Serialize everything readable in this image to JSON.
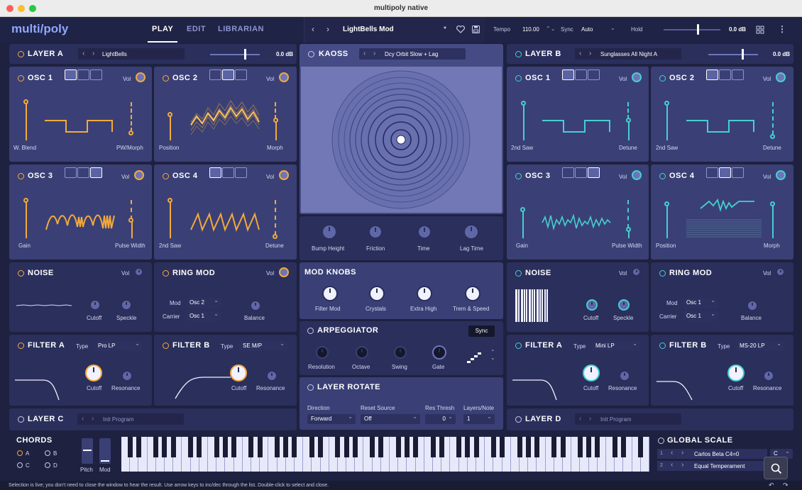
{
  "window": {
    "title": "multipoly native"
  },
  "header": {
    "logo": "multi/poly",
    "tabs": [
      {
        "label": "PLAY"
      },
      {
        "label": "EDIT"
      },
      {
        "label": "LIBRARIAN"
      }
    ],
    "preset_name": "LightBells Mod",
    "preset_modified": "*",
    "tempo_label": "Tempo",
    "tempo_value": "110.00",
    "sync_label": "Sync",
    "sync_value": "Auto",
    "hold_label": "Hold",
    "master_db": "0.0 dB"
  },
  "layer_a": {
    "title": "LAYER A",
    "program": "LightBells",
    "db": "0.0 dB",
    "osc1": {
      "title": "OSC 1",
      "vol": "Vol",
      "left": "W. Blend",
      "right": "PW/Morph"
    },
    "osc2": {
      "title": "OSC 2",
      "vol": "Vol",
      "left": "Position",
      "right": "Morph"
    },
    "osc3": {
      "title": "OSC 3",
      "vol": "Vol",
      "left": "Gain",
      "right": "Pulse Width"
    },
    "osc4": {
      "title": "OSC 4",
      "vol": "Vol",
      "left": "2nd Saw",
      "right": "Detune"
    },
    "noise": {
      "title": "NOISE",
      "vol": "Vol",
      "k1": "Cutoff",
      "k2": "Speckle"
    },
    "ringmod": {
      "title": "RING MOD",
      "vol": "Vol",
      "mod_label": "Mod",
      "mod_value": "Osc 2",
      "carrier_label": "Carrier",
      "carrier_value": "Osc 1",
      "k1": "Balance"
    },
    "filter_a": {
      "title": "FILTER A",
      "type_label": "Type",
      "type_value": "Pro LP",
      "k1": "Cutoff",
      "k2": "Resonance"
    },
    "filter_b": {
      "title": "FILTER B",
      "type_label": "Type",
      "type_value": "SE M/P",
      "k1": "Cutoff",
      "k2": "Resonance"
    }
  },
  "layer_b": {
    "title": "LAYER B",
    "program": "Sunglasses All Night A",
    "db": "0.0 dB",
    "osc1": {
      "title": "OSC 1",
      "vol": "Vol",
      "left": "2nd Saw",
      "right": "Detune"
    },
    "osc2": {
      "title": "OSC 2",
      "vol": "Vol",
      "left": "2nd Saw",
      "right": "Detune"
    },
    "osc3": {
      "title": "OSC 3",
      "vol": "Vol",
      "left": "Gain",
      "right": "Pulse Width"
    },
    "osc4": {
      "title": "OSC 4",
      "vol": "Vol",
      "left": "Position",
      "right": "Morph"
    },
    "noise": {
      "title": "NOISE",
      "vol": "Vol",
      "k1": "Cutoff",
      "k2": "Speckle"
    },
    "ringmod": {
      "title": "RING MOD",
      "vol": "Vol",
      "mod_label": "Mod",
      "mod_value": "Osc 1",
      "carrier_label": "Carrier",
      "carrier_value": "Osc 1",
      "k1": "Balance"
    },
    "filter_a": {
      "title": "FILTER A",
      "type_label": "Type",
      "type_value": "Mini LP",
      "k1": "Cutoff",
      "k2": "Resonance"
    },
    "filter_b": {
      "title": "FILTER B",
      "type_label": "Type",
      "type_value": "MS-20 LP",
      "k1": "Cutoff",
      "k2": "Resonance"
    }
  },
  "kaoss": {
    "title": "KAOSS",
    "program": "Dcy Orbit Slow + Lag",
    "knobs": [
      "Bump Height",
      "Friction",
      "Time",
      "Lag Time"
    ]
  },
  "mod_knobs": {
    "title": "MOD KNOBS",
    "knobs": [
      "Filter Mod",
      "Crystals",
      "Extra High",
      "Trem & Speed"
    ]
  },
  "arpeggiator": {
    "title": "ARPEGGIATOR",
    "sync": "Sync",
    "knobs": [
      "Resolution",
      "Octave",
      "Swing",
      "Gate"
    ]
  },
  "layer_rotate": {
    "title": "LAYER ROTATE",
    "direction_label": "Direction",
    "direction_value": "Forward",
    "reset_label": "Reset Source",
    "reset_value": "Off",
    "res_label": "Res Thresh",
    "res_value": "0",
    "layers_label": "Layers/Note",
    "layers_value": "1"
  },
  "layer_c": {
    "title": "LAYER C",
    "program": "Init Program"
  },
  "layer_d": {
    "title": "LAYER D",
    "program": "Init Program"
  },
  "chords": {
    "title": "CHORDS",
    "options": [
      "A",
      "B",
      "C",
      "D"
    ],
    "pitch": "Pitch",
    "mod": "Mod"
  },
  "global_scale": {
    "title": "GLOBAL SCALE",
    "rows": [
      {
        "index": "1",
        "name": "Carlos Beta C4=0",
        "key": "C"
      },
      {
        "index": "2",
        "name": "Equal Temperament"
      }
    ]
  },
  "status": {
    "text": "Selection is live; you don't need to close the window to hear the result. Use arrow keys to inc/dec through the list. Double-click to select and close."
  },
  "colors": {
    "accent_orange": "#f4a93c",
    "accent_teal": "#46cfcf",
    "panel": "#3a4075",
    "background": "#1e2140"
  }
}
